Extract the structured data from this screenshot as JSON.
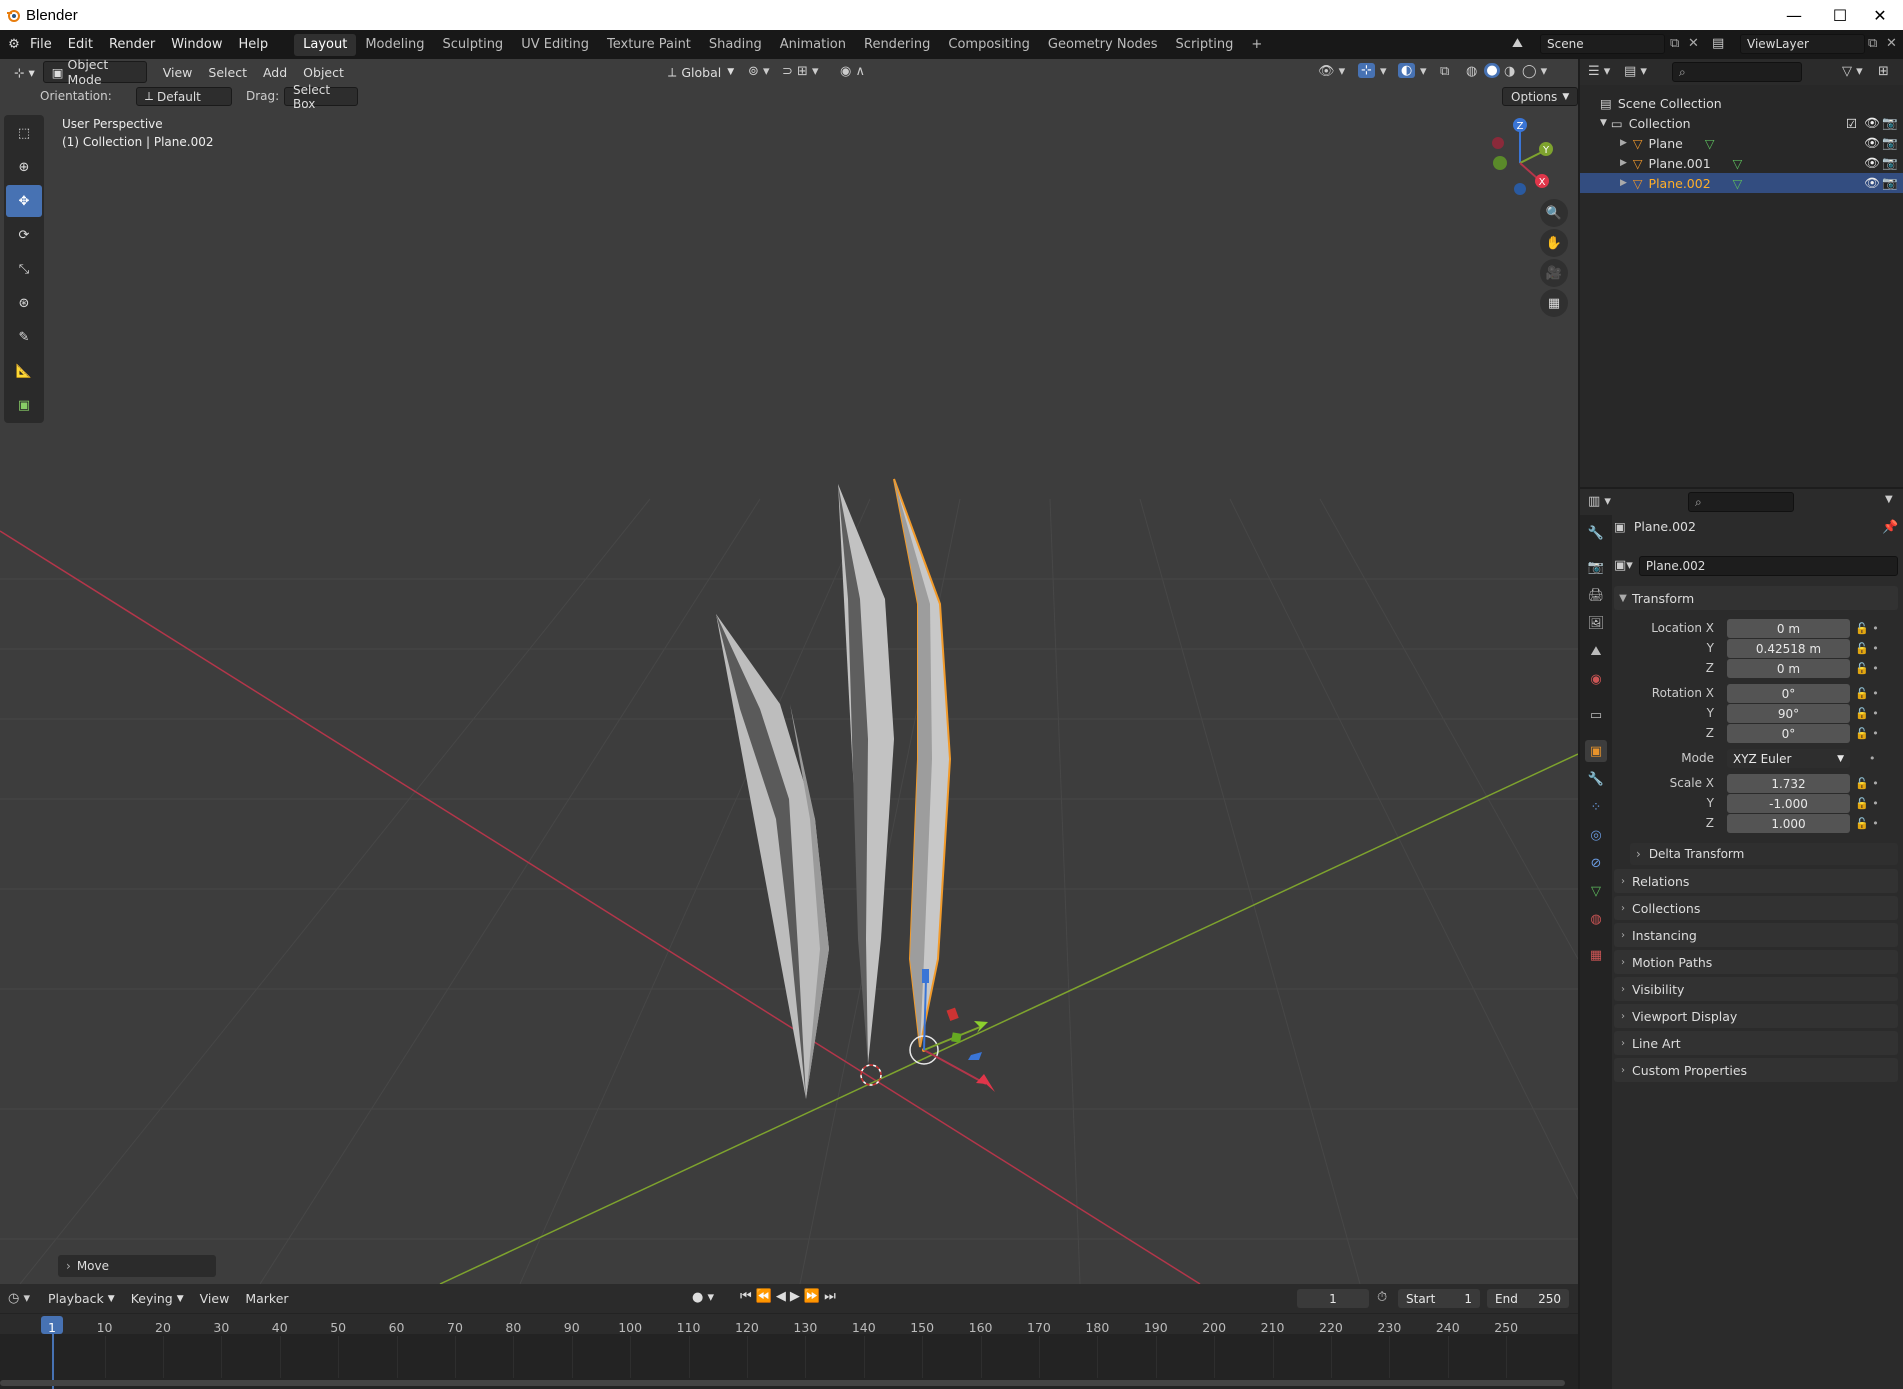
{
  "window": {
    "title": "Blender"
  },
  "menu": {
    "items": [
      "File",
      "Edit",
      "Render",
      "Window",
      "Help"
    ],
    "workspaces": [
      "Layout",
      "Modeling",
      "Sculpting",
      "UV Editing",
      "Texture Paint",
      "Shading",
      "Animation",
      "Rendering",
      "Compositing",
      "Geometry Nodes",
      "Scripting"
    ],
    "active_workspace": "Layout",
    "add_tab": "+",
    "scene": "Scene",
    "view_layer": "ViewLayer"
  },
  "viewport_header": {
    "mode": "Object Mode",
    "menus": [
      "View",
      "Select",
      "Add",
      "Object"
    ],
    "transform_orientation": "Global",
    "options_label": "Options"
  },
  "tool_settings": {
    "orientation_label": "Orientation:",
    "orientation_value": "Default",
    "drag_label": "Drag:",
    "drag_value": "Select Box"
  },
  "viewport": {
    "perspective_label": "User Perspective",
    "context_label": "(1) Collection | Plane.002",
    "last_operator": "Move",
    "gizmo_axes": {
      "x": "X",
      "y": "Y",
      "z": "Z"
    }
  },
  "outliner": {
    "root": "Scene Collection",
    "collection": "Collection",
    "objects": [
      "Plane",
      "Plane.001",
      "Plane.002"
    ],
    "selected": "Plane.002"
  },
  "properties": {
    "object_name": "Plane.002",
    "data_name": "Plane.002",
    "transform_title": "Transform",
    "location": {
      "label": "Location X",
      "x": "0 m",
      "y": "0.42518 m",
      "z": "0 m"
    },
    "rotation": {
      "label": "Rotation X",
      "x": "0°",
      "y": "90°",
      "z": "0°"
    },
    "mode_label": "Mode",
    "mode_value": "XYZ Euler",
    "scale": {
      "label": "Scale X",
      "x": "1.732",
      "y": "-1.000",
      "z": "1.000"
    },
    "axis_y": "Y",
    "axis_z": "Z",
    "delta_transform": "Delta Transform",
    "panels": [
      "Relations",
      "Collections",
      "Instancing",
      "Motion Paths",
      "Visibility",
      "Viewport Display",
      "Line Art",
      "Custom Properties"
    ]
  },
  "timeline": {
    "menus": [
      "Playback",
      "Keying",
      "View",
      "Marker"
    ],
    "current_frame": "1",
    "start_label": "Start",
    "start_value": "1",
    "end_label": "End",
    "end_value": "250",
    "ticks": [
      "1",
      "10",
      "20",
      "30",
      "40",
      "50",
      "60",
      "70",
      "80",
      "90",
      "100",
      "110",
      "120",
      "130",
      "140",
      "150",
      "160",
      "170",
      "180",
      "190",
      "200",
      "210",
      "220",
      "230",
      "240",
      "250"
    ]
  },
  "colors": {
    "accent": "#4772b3",
    "selection_outline": "#f29b2b",
    "x_axis": "#b3364a",
    "y_axis": "#7ea32e",
    "z_axis": "#3a75d6"
  }
}
